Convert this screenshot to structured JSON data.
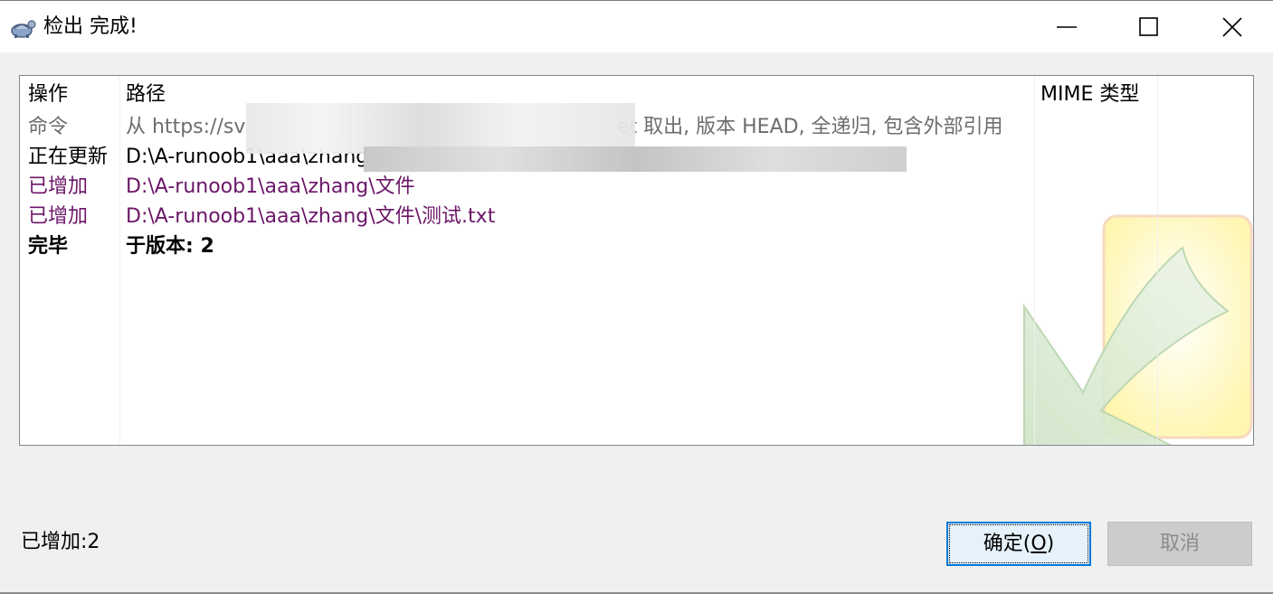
{
  "window": {
    "title": "检出 完成!",
    "icon": "tortoise-icon",
    "controls": [
      "minimize-icon",
      "maximize-icon",
      "close-icon"
    ]
  },
  "list": {
    "columns": [
      "操作",
      "路径",
      "MIME 类型"
    ],
    "rows": [
      {
        "action": "命令",
        "path": "从 https://sv",
        "path_tail": "et 取出, 版本 HEAD, 全递归, 包含外部引用",
        "style": "gray"
      },
      {
        "action": "正在更新",
        "path": "D:\\A-runoob1\\aaa\\zhang",
        "style": "black"
      },
      {
        "action": "已增加",
        "path": "D:\\A-runoob1\\aaa\\zhang\\文件",
        "style": "purple"
      },
      {
        "action": "已增加",
        "path": "D:\\A-runoob1\\aaa\\zhang\\文件\\测试.txt",
        "style": "purple"
      },
      {
        "action": "完毕",
        "path": "于版本: 2",
        "style": "bold"
      }
    ]
  },
  "status": {
    "text": "已增加:2"
  },
  "buttons": {
    "ok": "确定(O)",
    "ok_prefix": "确定(",
    "ok_mnemonic": "O",
    "ok_suffix": ")",
    "cancel": "取消"
  }
}
